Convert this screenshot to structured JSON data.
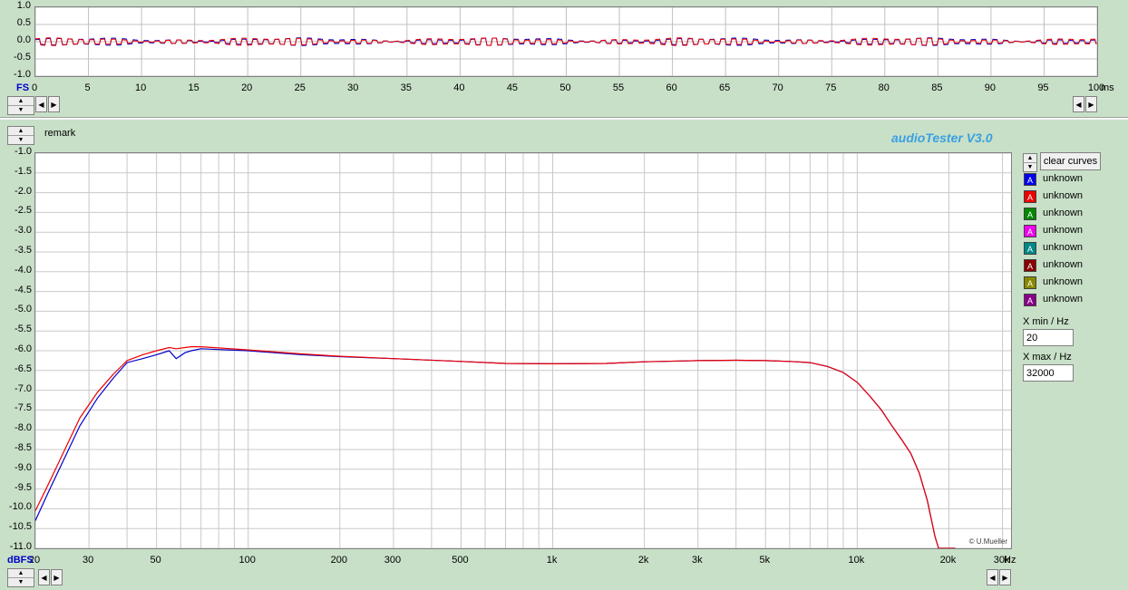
{
  "app_title": "audioTester  V3.0",
  "remark_label": "remark",
  "copyright": "© U.Mueller",
  "clear_curves_label": "clear curves",
  "xmin_label": "X min / Hz",
  "xmin_value": "20",
  "xmax_label": "X max / Hz",
  "xmax_value": "32000",
  "legend": [
    {
      "label": "unknown",
      "color": "#0000ee",
      "icon": "A"
    },
    {
      "label": "unknown",
      "color": "#ee0000",
      "icon": "A"
    },
    {
      "label": "unknown",
      "color": "#008800",
      "icon": "A"
    },
    {
      "label": "unknown",
      "color": "#ee00ee",
      "icon": "A"
    },
    {
      "label": "unknown",
      "color": "#008888",
      "icon": "A"
    },
    {
      "label": "unknown",
      "color": "#880000",
      "icon": "A"
    },
    {
      "label": "unknown",
      "color": "#888800",
      "icon": "A"
    },
    {
      "label": "unknown",
      "color": "#880088",
      "icon": "A"
    }
  ],
  "time_plot": {
    "unit_left": "FS",
    "unit_right": "ms",
    "yticks": [
      "1.0",
      "0.5",
      "0.0",
      "-0.5",
      "-1.0"
    ],
    "xticks": [
      "0",
      "5",
      "10",
      "15",
      "20",
      "25",
      "30",
      "35",
      "40",
      "45",
      "50",
      "55",
      "60",
      "65",
      "70",
      "75",
      "80",
      "85",
      "90",
      "95",
      "100"
    ]
  },
  "chart_data": {
    "type": "line",
    "title": "",
    "xlabel": "Hz",
    "ylabel": "dBFS",
    "xscale": "log",
    "xlim": [
      20,
      32000
    ],
    "ylim": [
      -11.0,
      -1.0
    ],
    "grid": true,
    "yticks": [
      "-1.0",
      "-1.5",
      "-2.0",
      "-2.5",
      "-3.0",
      "-3.5",
      "-4.0",
      "-4.5",
      "-5.0",
      "-5.5",
      "-6.0",
      "-6.5",
      "-7.0",
      "-7.5",
      "-8.0",
      "-8.5",
      "-9.0",
      "-9.5",
      "-10.0",
      "-10.5",
      "-11.0"
    ],
    "xtick_labels": [
      {
        "v": 20,
        "t": "20"
      },
      {
        "v": 30,
        "t": "30"
      },
      {
        "v": 50,
        "t": "50"
      },
      {
        "v": 100,
        "t": "100"
      },
      {
        "v": 200,
        "t": "200"
      },
      {
        "v": 300,
        "t": "300"
      },
      {
        "v": 500,
        "t": "500"
      },
      {
        "v": 1000,
        "t": "1k"
      },
      {
        "v": 2000,
        "t": "2k"
      },
      {
        "v": 3000,
        "t": "3k"
      },
      {
        "v": 5000,
        "t": "5k"
      },
      {
        "v": 10000,
        "t": "10k"
      },
      {
        "v": 20000,
        "t": "20k"
      },
      {
        "v": 30000,
        "t": "30k"
      }
    ],
    "unit_left": "dBFS",
    "unit_right": "Hz",
    "series": [
      {
        "color": "#0000cc",
        "x": [
          20,
          22,
          25,
          28,
          32,
          36,
          40,
          45,
          50,
          55,
          58,
          62,
          65,
          70,
          80,
          100,
          150,
          200,
          300,
          500,
          700,
          1000,
          1500,
          2000,
          3000,
          4000,
          5000,
          6000,
          7000,
          8000,
          9000,
          10000,
          11000,
          12000,
          13000,
          14000,
          15000,
          16000,
          17000,
          18000,
          18500,
          19000,
          20000,
          21000
        ],
        "y": [
          -10.3,
          -9.6,
          -8.7,
          -7.9,
          -7.2,
          -6.7,
          -6.3,
          -6.2,
          -6.1,
          -6.0,
          -6.2,
          -6.05,
          -6.0,
          -5.95,
          -5.97,
          -6.0,
          -6.1,
          -6.15,
          -6.2,
          -6.27,
          -6.32,
          -6.33,
          -6.32,
          -6.28,
          -6.25,
          -6.24,
          -6.25,
          -6.27,
          -6.3,
          -6.4,
          -6.55,
          -6.8,
          -7.15,
          -7.5,
          -7.9,
          -8.25,
          -8.6,
          -9.1,
          -9.8,
          -10.7,
          -11.0,
          -11.0,
          -11.0,
          -11.0
        ]
      },
      {
        "color": "#ee0000",
        "x": [
          20,
          22,
          25,
          28,
          32,
          36,
          40,
          45,
          50,
          55,
          58,
          62,
          65,
          70,
          80,
          100,
          150,
          200,
          300,
          500,
          700,
          1000,
          1500,
          2000,
          3000,
          4000,
          5000,
          6000,
          7000,
          8000,
          9000,
          10000,
          11000,
          12000,
          13000,
          14000,
          15000,
          16000,
          17000,
          18000,
          18500,
          19000,
          20000,
          21000
        ],
        "y": [
          -10.05,
          -9.4,
          -8.5,
          -7.7,
          -7.05,
          -6.6,
          -6.25,
          -6.1,
          -6.0,
          -5.92,
          -5.95,
          -5.92,
          -5.9,
          -5.9,
          -5.93,
          -5.98,
          -6.08,
          -6.14,
          -6.2,
          -6.27,
          -6.32,
          -6.33,
          -6.32,
          -6.28,
          -6.25,
          -6.24,
          -6.25,
          -6.27,
          -6.3,
          -6.4,
          -6.55,
          -6.8,
          -7.15,
          -7.5,
          -7.9,
          -8.25,
          -8.6,
          -9.1,
          -9.8,
          -10.7,
          -11.0,
          -11.0,
          -11.0,
          -11.0
        ]
      }
    ]
  }
}
